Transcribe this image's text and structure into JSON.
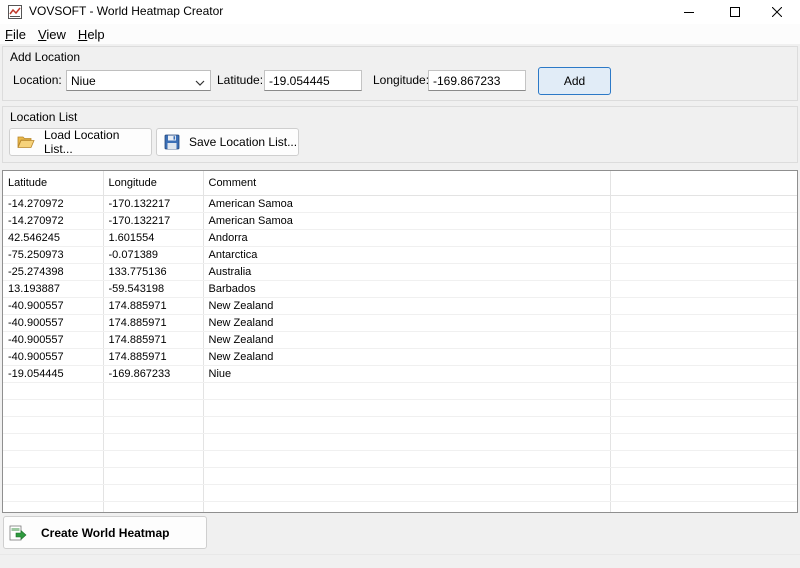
{
  "window": {
    "title": "VOVSOFT - World Heatmap Creator",
    "controls": [
      "minimize",
      "maximize",
      "close"
    ]
  },
  "menu": {
    "items": [
      "File",
      "View",
      "Help"
    ]
  },
  "add_location": {
    "group_title": "Add Location",
    "location_label": "Location:",
    "location_value": "Niue",
    "latitude_label": "Latitude:",
    "latitude_value": "-19.054445",
    "longitude_label": "Longitude:",
    "longitude_value": "-169.867233",
    "add_button": "Add"
  },
  "location_list": {
    "group_title": "Location List",
    "load_button": "Load Location List...",
    "save_button": "Save Location List..."
  },
  "table": {
    "headers": [
      "Latitude",
      "Longitude",
      "Comment"
    ],
    "rows": [
      [
        "-14.270972",
        "-170.132217",
        "American Samoa"
      ],
      [
        "-14.270972",
        "-170.132217",
        "American Samoa"
      ],
      [
        "42.546245",
        "1.601554",
        "Andorra"
      ],
      [
        "-75.250973",
        "-0.071389",
        "Antarctica"
      ],
      [
        "-25.274398",
        "133.775136",
        "Australia"
      ],
      [
        "13.193887",
        "-59.543198",
        "Barbados"
      ],
      [
        "-40.900557",
        "174.885971",
        "New Zealand"
      ],
      [
        "-40.900557",
        "174.885971",
        "New Zealand"
      ],
      [
        "-40.900557",
        "174.885971",
        "New Zealand"
      ],
      [
        "-40.900557",
        "174.885971",
        "New Zealand"
      ],
      [
        "-19.054445",
        "-169.867233",
        "Niue"
      ]
    ]
  },
  "actions": {
    "create_button": "Create World Heatmap"
  },
  "colors": {
    "accent": "#2c79c7",
    "add_button_bg": "#e1ecf7",
    "window_bg": "#f0f0f0"
  },
  "icons": {
    "app": "app-icon",
    "load": "folder-open-icon",
    "save": "floppy-disk-icon",
    "create": "export-arrow-icon"
  }
}
